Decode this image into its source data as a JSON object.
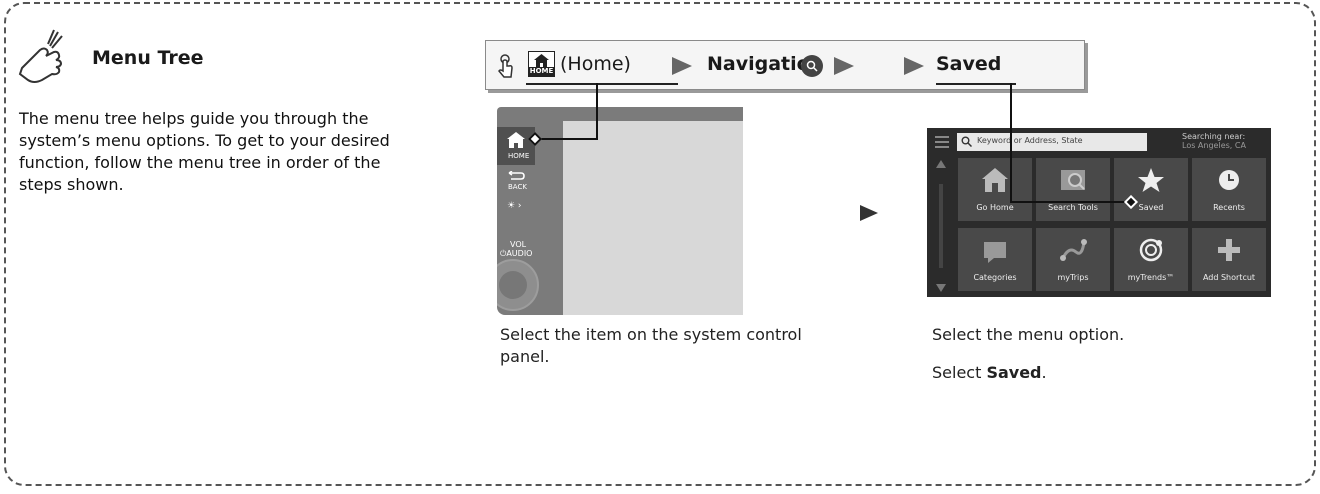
{
  "menu_tree": {
    "title": "Menu Tree",
    "description": "The menu tree helps guide you through the system’s menu options. To get to your desired function, follow the menu tree in order of the steps shown."
  },
  "path": {
    "home_badge": "HOME",
    "home_label": "(Home)",
    "navigation_label": "Navigation",
    "saved_label": "Saved"
  },
  "control_panel": {
    "home_label": "HOME",
    "back_label": "BACK",
    "brightness_label": "☀ ›",
    "vol_label": "VOL",
    "audio_label": "⏻AUDIO"
  },
  "nav_screen": {
    "search_placeholder": "Keyword or Address, State",
    "searching_near": "Searching near:",
    "location": "Los Angeles, CA",
    "tiles": [
      {
        "label": "Go Home",
        "icon": "house-icon"
      },
      {
        "label": "Search Tools",
        "icon": "map-search-icon"
      },
      {
        "label": "Saved",
        "icon": "star-icon"
      },
      {
        "label": "Recents",
        "icon": "clock-icon"
      },
      {
        "label": "Categories",
        "icon": "map-pin-icon"
      },
      {
        "label": "myTrips",
        "icon": "route-icon"
      },
      {
        "label": "myTrends™",
        "icon": "trends-icon"
      },
      {
        "label": "Add Shortcut",
        "icon": "plus-icon"
      }
    ]
  },
  "captions": {
    "left": "Select the item on the system control panel.",
    "right1": "Select the menu option.",
    "right2_prefix": "Select ",
    "right2_bold": "Saved",
    "right2_suffix": "."
  }
}
